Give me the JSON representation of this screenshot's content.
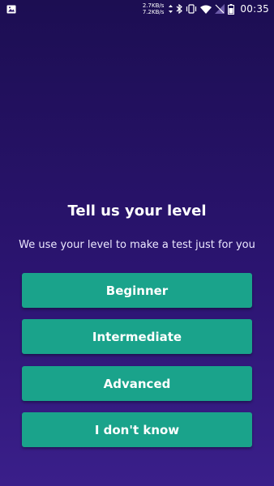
{
  "status_bar": {
    "upload_speed": "2.7KB/s",
    "download_speed": "7.2KB/s",
    "time": "00:35"
  },
  "screen": {
    "title": "Tell us your level",
    "subtitle": "We use your level to make a test just for you"
  },
  "levels": [
    {
      "label": "Beginner"
    },
    {
      "label": "Intermediate"
    },
    {
      "label": "Advanced"
    },
    {
      "label": "I don't know"
    }
  ],
  "colors": {
    "background_top": "#1c0e52",
    "background_bottom": "#3a1f8a",
    "button": "#1aa38b",
    "text": "#ffffff"
  }
}
